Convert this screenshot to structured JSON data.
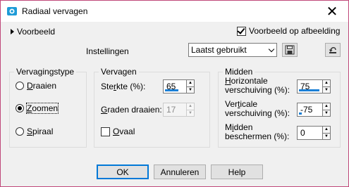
{
  "window": {
    "title": "Radiaal vervagen",
    "close_glyph": "✕",
    "accent": "#0078d7"
  },
  "preview": {
    "expander_label": "Voorbeeld",
    "on_image_label": "Voorbeeld op afbeelding",
    "on_image_checked": true
  },
  "settings": {
    "label": "Instellingen",
    "preset": "Laatst gebruikt"
  },
  "icons": {
    "save": "save-disk-icon",
    "reset": "reset-icon"
  },
  "type_group": {
    "legend": "Vervagingstype",
    "options": [
      {
        "label": "Draaien",
        "selected": false
      },
      {
        "label": "Zoomen",
        "selected": true
      },
      {
        "label": "Spiraal",
        "selected": false
      }
    ]
  },
  "blur_group": {
    "legend": "Vervagen",
    "strength_label": "Sterkte (%):",
    "strength_value": "65",
    "strength_fraction": 0.65,
    "twist_label": "Graden draaien:",
    "twist_value": "17",
    "twist_fraction": 0.17,
    "oval_label": "Ovaal",
    "oval_checked": false
  },
  "center_group": {
    "legend": "Midden",
    "h_label_1": "Horizontale",
    "h_label_2": "verschuiving (%):",
    "h_value": "75",
    "h_fraction": 0.875,
    "v_label_1": "Verticale",
    "v_label_2": "verschuiving (%):",
    "v_value": "-75",
    "v_fraction": 0.125,
    "p_label_1": "Midden",
    "p_label_2": "beschermen (%):",
    "p_value": "0",
    "p_fraction": 0
  },
  "buttons": {
    "ok": "OK",
    "cancel": "Annuleren",
    "help": "Help"
  }
}
